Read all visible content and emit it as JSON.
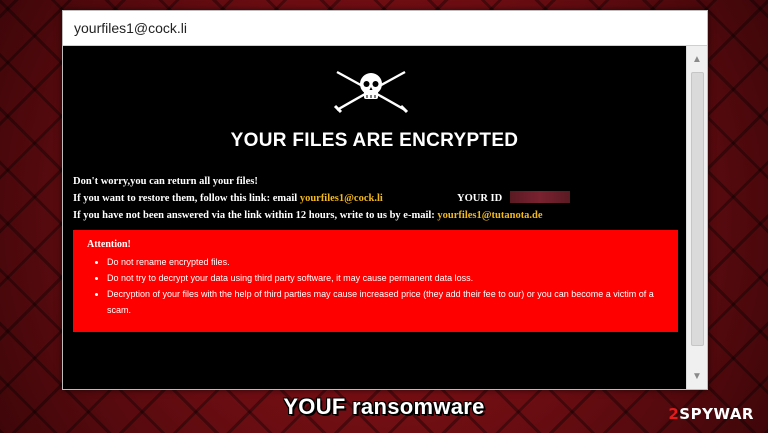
{
  "window": {
    "title": "yourfiles1@cock.li"
  },
  "note": {
    "headline": "YOUR FILES ARE ENCRYPTED",
    "line1": "Don't worry,you can return all your files!",
    "line2_prefix": "If you want to restore them, follow this link: email",
    "line2_email": "yourfiles1@cock.li",
    "id_label": "YOUR ID",
    "line3_prefix": "If you have not been answered via the link within 12 hours, write to us by e-mail:",
    "line3_email": "yourfiles1@tutanota.de",
    "attention_title": "Attention!",
    "attention_items": [
      "Do not rename encrypted files.",
      "Do not try to decrypt your data using third party software, it may cause permanent data loss.",
      "Decryption of your files with the help of third parties may cause increased price (they add their fee to our) or you can become a victim of a scam."
    ]
  },
  "caption": "YOUF ransomware",
  "brand": {
    "prefix": "2",
    "name": "SPYWAR",
    "suffix": ""
  },
  "colors": {
    "accent_red": "#ff0000",
    "email_yellow": "#f2b91a",
    "window_bg": "#000000"
  },
  "icons": {
    "skull": "skull-crossed-swords-icon"
  }
}
